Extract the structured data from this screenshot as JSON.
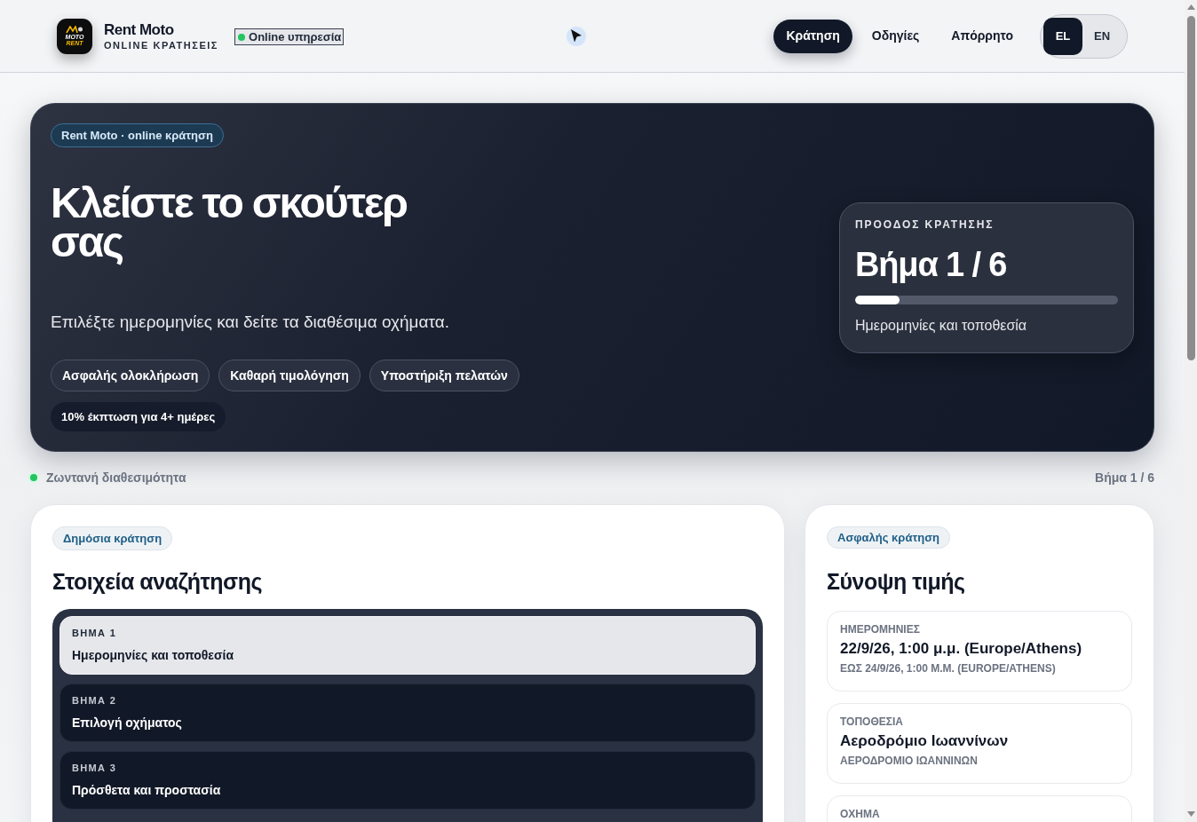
{
  "header": {
    "logo_words": [
      "MOTO",
      "RENT"
    ],
    "brand": "Rent Moto",
    "tagline": "ONLINE ΚΡΑΤΗΣΕΙΣ",
    "status": "Online υπηρεσία",
    "nav": [
      {
        "label": "Κράτηση",
        "selected": true
      },
      {
        "label": "Οδηγίες",
        "selected": false
      },
      {
        "label": "Απόρρητο",
        "selected": false
      }
    ],
    "languages": [
      {
        "label": "EL",
        "selected": true
      },
      {
        "label": "EN",
        "selected": false
      }
    ]
  },
  "hero": {
    "eyebrow": "Rent Moto · online κράτηση",
    "title": "Κλείστε το σκούτερ σας",
    "subtitle": "Επιλέξτε ημερομηνίες και δείτε τα διαθέσιμα οχήματα.",
    "features": [
      {
        "label": "Ασφαλής ολοκλήρωση",
        "kind": "outlined"
      },
      {
        "label": "Καθαρή τιμολόγηση",
        "kind": "outlined"
      },
      {
        "label": "Υποστήριξη πελατών",
        "kind": "outlined"
      },
      {
        "label": "10% έκπτωση για 4+ ημέρες",
        "kind": "promo"
      }
    ],
    "progress": {
      "label": "ΠΡΟΟΔΟΣ ΚΡΑΤΗΣΗΣ",
      "step": "Βήμα 1 / 6",
      "level": 0.17,
      "caption": "Ημερομηνίες και τοποθεσία"
    }
  },
  "status_row": {
    "live": "Ζωντανή διαθεσιμότητα",
    "step": "Βήμα 1 / 6"
  },
  "search_panel": {
    "badge": "Δημόσια κράτηση",
    "title": "Στοιχεία αναζήτησης",
    "steps": [
      {
        "label": "ΒΗΜΑ 1",
        "title": "Ημερομηνίες και τοποθεσία",
        "selected": true
      },
      {
        "label": "ΒΗΜΑ 2",
        "title": "Επιλογή οχήματος",
        "selected": false
      },
      {
        "label": "ΒΗΜΑ 3",
        "title": "Πρόσθετα και προστασία",
        "selected": false
      }
    ]
  },
  "summary_panel": {
    "badge": "Ασφαλής κράτηση",
    "title": "Σύνοψη τιμής",
    "items": [
      {
        "label": "ΗΜΕΡΟΜΗΝΙΕΣ",
        "value": "22/9/26, 1:00 μ.μ. (Europe/Athens)",
        "detail": "ΕΩΣ 24/9/26, 1:00 Μ.Μ. (EUROPE/ATHENS)"
      },
      {
        "label": "ΤΟΠΟΘΕΣΙΑ",
        "value": "Αεροδρόμιο Ιωαννίνων",
        "detail": "ΑΕΡΟΔΡΟΜΙΟ ΙΩΑΝΝΙΝΩΝ"
      },
      {
        "label": "ΟΧΗΜΑ"
      }
    ]
  }
}
